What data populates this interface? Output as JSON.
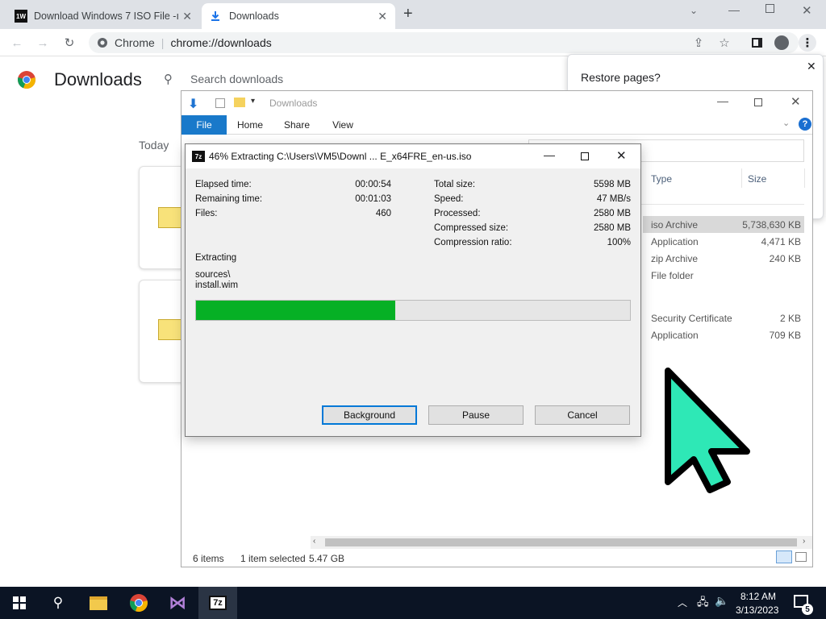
{
  "browser": {
    "tabs": [
      {
        "label": "Download Windows 7 ISO File -ı",
        "favicon": "1W",
        "active": false
      },
      {
        "label": "Downloads",
        "active": true
      }
    ],
    "omnibox": {
      "site_label": "Chrome",
      "url": "chrome://downloads"
    }
  },
  "downloads_page": {
    "title": "Downloads",
    "search_placeholder": "Search downloads",
    "section_today": "Today"
  },
  "restore_popup": {
    "text": "Restore pages?"
  },
  "explorer": {
    "title": "Downloads",
    "ribbon_tabs": [
      "File",
      "Home",
      "Share",
      "View"
    ],
    "column_type": "Type",
    "column_size": "Size",
    "rows": [
      {
        "type": "iso Archive",
        "size": "5,738,630 KB",
        "selected": true
      },
      {
        "type": "Application",
        "size": "4,471 KB"
      },
      {
        "type": "zip Archive",
        "size": "240 KB"
      },
      {
        "type": "File folder",
        "size": ""
      },
      {
        "type": "Security Certificate",
        "size": "2 KB"
      },
      {
        "type": "Application",
        "size": "709 KB"
      }
    ],
    "status_items": "6 items",
    "status_selected": "1 item selected",
    "status_size": "5.47 GB"
  },
  "sevenzip": {
    "title": "46% Extracting C:\\Users\\VM5\\Downl ... E_x64FRE_en-us.iso",
    "icon": "7z",
    "left_stats": [
      {
        "label": "Elapsed time:",
        "value": "00:00:54"
      },
      {
        "label": "Remaining time:",
        "value": "00:01:03"
      },
      {
        "label": "Files:",
        "value": "460"
      }
    ],
    "right_stats": [
      {
        "label": "Total size:",
        "value": "5598 MB"
      },
      {
        "label": "Speed:",
        "value": "47 MB/s"
      },
      {
        "label": "Processed:",
        "value": "2580 MB"
      },
      {
        "label": "Compressed size:",
        "value": "2580 MB"
      },
      {
        "label": "Compression ratio:",
        "value": "100%"
      }
    ],
    "status": "Extracting",
    "current_path": "sources\\",
    "current_file": "install.wim",
    "progress": 0.46,
    "progress_color": "#06b025",
    "buttons": {
      "background": "Background",
      "pause": "Pause",
      "cancel": "Cancel"
    }
  },
  "taskbar": {
    "time": "8:12 AM",
    "date": "3/13/2023",
    "notification_count": "5",
    "apps": [
      "windows-start",
      "search",
      "file-explorer",
      "chrome",
      "visual-studio",
      "7-zip"
    ]
  },
  "colors": {
    "cursor": "#2ee8b6",
    "accent": "#0063b1"
  }
}
